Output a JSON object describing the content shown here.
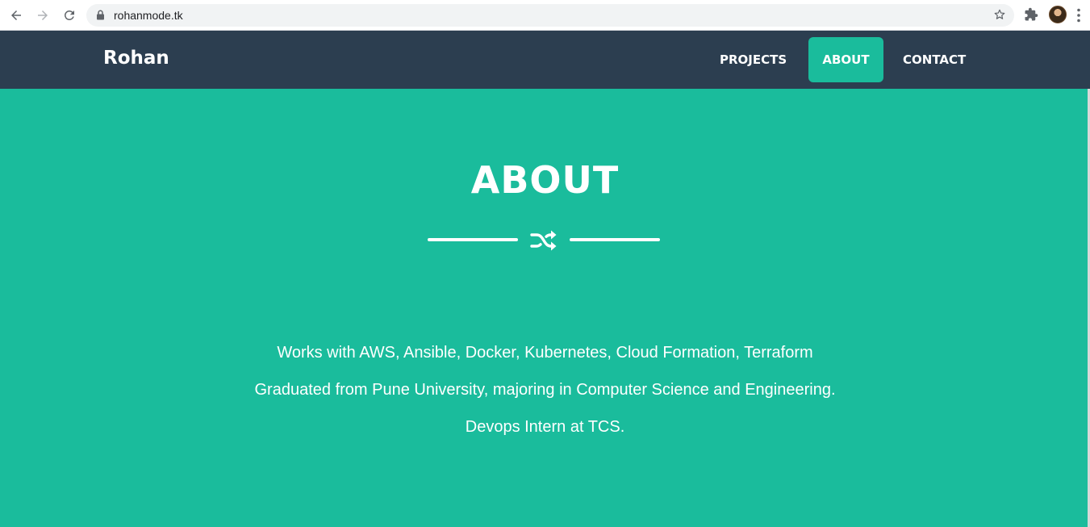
{
  "browser": {
    "url": "rohanmode.tk"
  },
  "navbar": {
    "brand": "Rohan",
    "links": [
      {
        "label": "PROJECTS",
        "active": false
      },
      {
        "label": "ABOUT",
        "active": true
      },
      {
        "label": "CONTACT",
        "active": false
      }
    ]
  },
  "about": {
    "heading": "ABOUT",
    "divider_icon": "shuffle-icon",
    "lines": [
      "Works with AWS, Ansible, Docker, Kubernetes, Cloud Formation, Terraform",
      "Graduated from Pune University, majoring in Computer Science and Engineering.",
      "Devops Intern at TCS."
    ]
  },
  "colors": {
    "navbar_bg": "#2c3e50",
    "accent": "#1abc9c",
    "text": "#ffffff"
  }
}
